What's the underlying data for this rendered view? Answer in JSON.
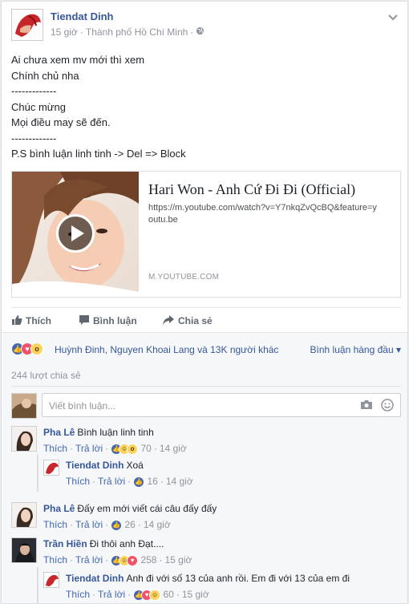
{
  "post": {
    "author": "Tiendat Dinh",
    "time": "15 giờ",
    "location": "Thành phố Hồ Chí Minh",
    "lines": [
      "Ai chưa xem mv mới thì xem",
      "Chính chủ nha",
      "-------------",
      "Chúc mừng",
      "Mọi điều may sẽ đến.",
      "-------------",
      "P.S bình luận linh tinh -> Del => Block"
    ]
  },
  "link_card": {
    "title": "Hari Won - Anh Cứ Đi Đi (Official)",
    "url": "https://m.youtube.com/watch?v=Y7nkqZvQcBQ&feature=youtu.be",
    "domain": "M.YOUTUBE.COM"
  },
  "actions": {
    "like": "Thích",
    "comment": "Bình luận",
    "share": "Chia sẻ"
  },
  "reactions": {
    "summary": "Huỳnh Đinh, Nguyen Khoai Lang và 13K người khác",
    "sort_label": "Bình luận hàng đầu",
    "shares": "244 lượt chia sẻ"
  },
  "comment_box": {
    "placeholder": "Viết bình luận..."
  },
  "comments": [
    {
      "author": "Pha Lê",
      "text": "Bình luận linh tinh",
      "like": "Thích",
      "reply": "Trả lời",
      "count": "70",
      "time": "14 giờ",
      "replies": [
        {
          "author": "Tiendat Dinh",
          "text": "Xoá",
          "like": "Thích",
          "reply": "Trả lời",
          "count": "16",
          "time": "14 giờ"
        }
      ]
    },
    {
      "author": "Pha Lê",
      "text": "Đấy em mới viết cái câu đấy đấy",
      "like": "Thích",
      "reply": "Trả lời",
      "count": "26",
      "time": "14 giờ",
      "replies": []
    },
    {
      "author": "Trần Hiền",
      "text": "Đi thôi anh Đạt....",
      "like": "Thích",
      "reply": "Trả lời",
      "count": "258",
      "time": "15 giờ",
      "replies": [
        {
          "author": "Tiendat Dinh",
          "text": "Anh đi với số 13 của anh rồi. Em đi với 13 của em đi",
          "like": "Thích",
          "reply": "Trả lời",
          "count": "60",
          "time": "15 giờ"
        }
      ]
    }
  ],
  "colors": {
    "link_blue": "#365899",
    "action_grey": "#616770",
    "meta_grey": "#90949c"
  }
}
